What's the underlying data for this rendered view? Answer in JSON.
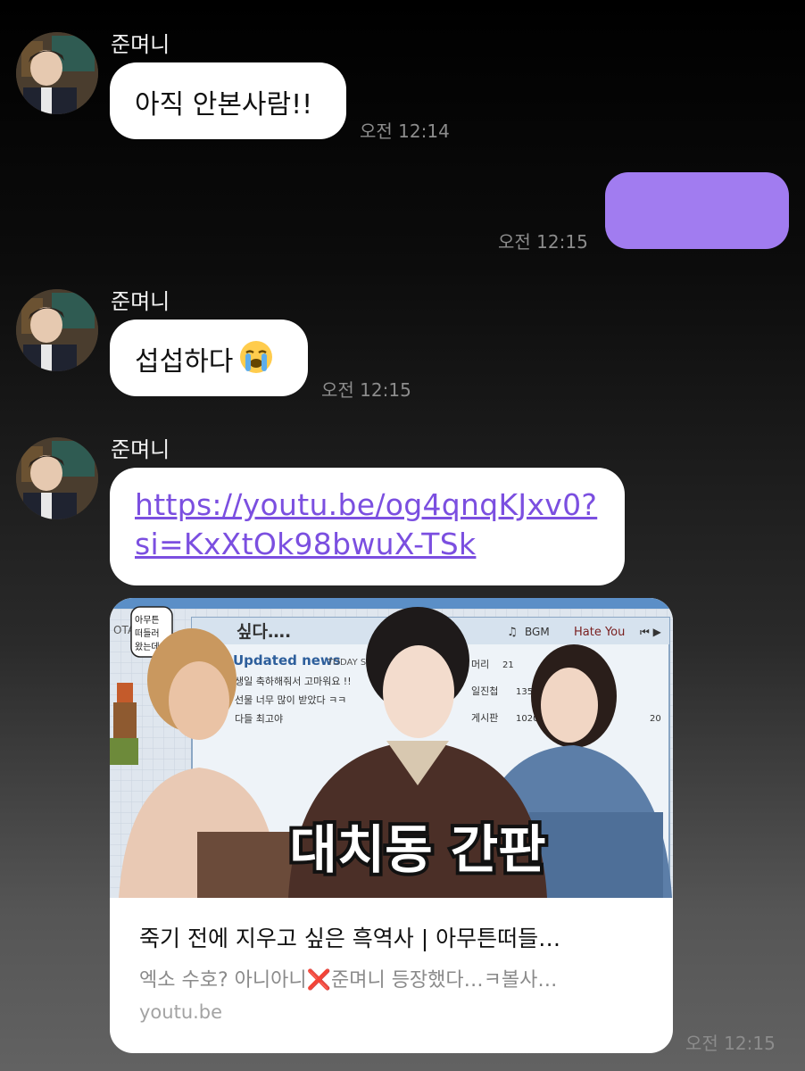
{
  "chat": {
    "sender_name": "준며니",
    "messages": [
      {
        "from": "other",
        "text": "아직 안본사람!!",
        "time": "오전 12:14"
      },
      {
        "from": "me",
        "text": "",
        "time": "오전 12:15"
      },
      {
        "from": "other",
        "text": "섭섭하다",
        "emoji": "loudly-crying-face",
        "time": "오전 12:15"
      },
      {
        "from": "other",
        "link_line1": "https://youtu.be/og4qnqKJxv0?",
        "link_line2": "si=KxXtOk98bwuX-TSk",
        "time": ""
      }
    ],
    "preview": {
      "title": "죽기 전에 지우고 싶은 흑역사 | 아무튼떠들…",
      "description": "엑소 수호? 아니아니❌준며니 등장했다…ㅋ볼사…",
      "domain": "youtu.be",
      "time": "오전 12:15",
      "thumbnail": {
        "caption": "대치동 간판",
        "top_text": "싶다….",
        "bgm_label": "BGM",
        "song": "Hate You",
        "updated_news": "Updated news",
        "today": "TODAY ST",
        "news_lines": [
          "생일 축하해줘서 고마워요 !!",
          "선물 너무 많이 받았다 ㅋㅋ",
          "다들 최고야"
        ],
        "stats": [
          {
            "k": "머리",
            "v": "21"
          },
          {
            "k": "일진첩",
            "v": "1356/1367"
          },
          {
            "k": "게시판",
            "v": "1020/1990"
          }
        ],
        "stats_extra": "20",
        "sticker": "아무튼 떠들러 왔는데",
        "left_tab": "OTA"
      }
    }
  },
  "colors": {
    "my_bubble": "#a17cf0",
    "link": "#7b4fe0"
  }
}
